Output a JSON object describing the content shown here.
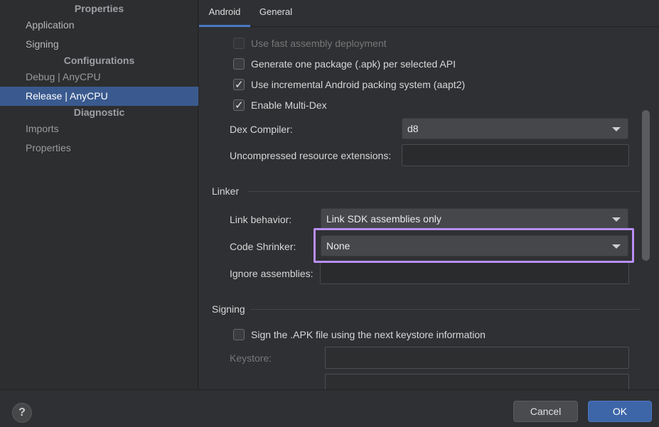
{
  "sidebar": {
    "headers": {
      "properties": "Properties",
      "configurations": "Configurations",
      "diagnostic": "Diagnostic"
    },
    "items": {
      "application": "Application",
      "signing": "Signing",
      "debug": "Debug | AnyCPU",
      "release": "Release | AnyCPU",
      "imports": "Imports",
      "properties": "Properties"
    },
    "selected": "Release | AnyCPU"
  },
  "tabs": {
    "android": "Android",
    "general": "General",
    "active": "Android"
  },
  "build": {
    "fast_deploy": {
      "label": "Use fast assembly deployment",
      "checked": false,
      "enabled": false
    },
    "one_package": {
      "label": "Generate one package (.apk) per selected API",
      "checked": false
    },
    "aapt2": {
      "label": "Use incremental Android packing system (aapt2)",
      "checked": true
    },
    "multidex": {
      "label": "Enable Multi-Dex",
      "checked": true
    },
    "dex_compiler": {
      "label": "Dex Compiler:",
      "value": "d8"
    },
    "uncompressed": {
      "label": "Uncompressed resource extensions:",
      "value": ""
    }
  },
  "linker": {
    "title": "Linker",
    "link_behavior": {
      "label": "Link behavior:",
      "value": "Link SDK assemblies only"
    },
    "code_shrinker": {
      "label": "Code Shrinker:",
      "value": "None"
    },
    "ignore_assemblies": {
      "label": "Ignore assemblies:",
      "value": ""
    }
  },
  "signing": {
    "title": "Signing",
    "sign_apk": {
      "label": "Sign the .APK file using the next keystore information",
      "checked": false
    },
    "keystore": {
      "label": "Keystore:",
      "value": ""
    }
  },
  "footer": {
    "help": "?",
    "cancel": "Cancel",
    "ok": "OK"
  },
  "colors": {
    "accent": "#3d66a8",
    "highlight": "#b98ef5",
    "selected_row": "#3a5a8f"
  }
}
